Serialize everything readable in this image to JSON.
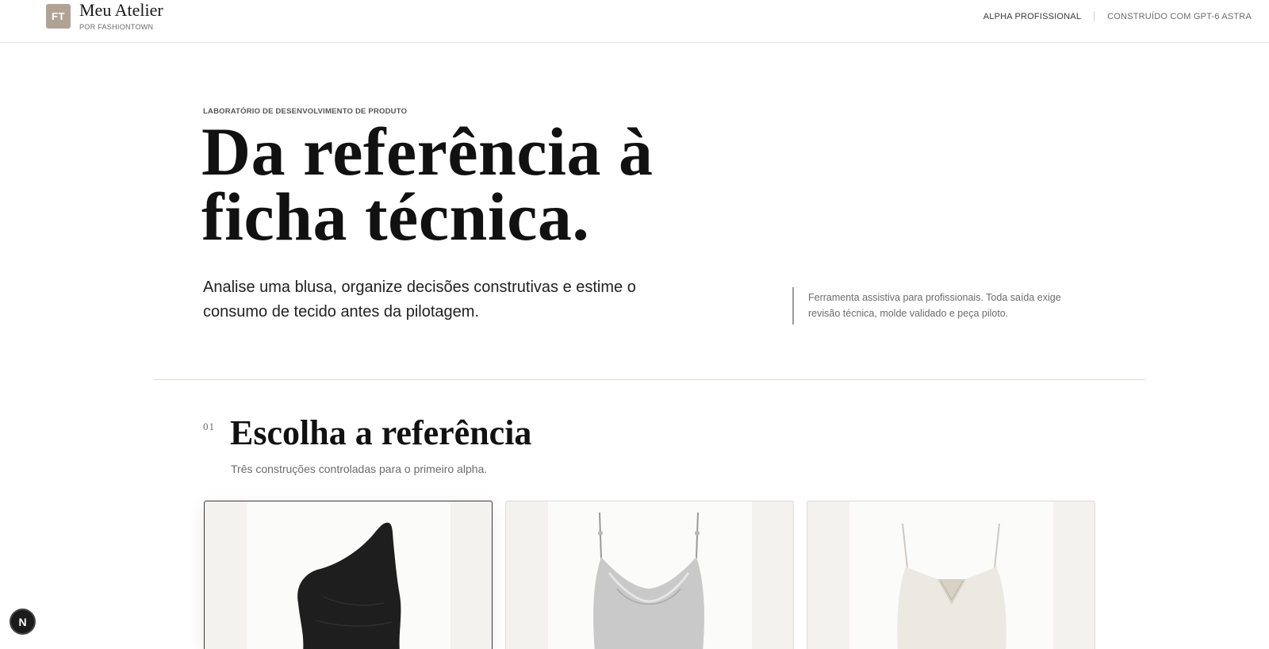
{
  "header": {
    "logo_initials": "FT",
    "brand_name": "Meu Atelier",
    "brand_sub": "POR FASHIONTOWN",
    "nav": [
      "ALPHA PROFISSIONAL",
      "CONSTRUÍDO COM GPT-6 ASTRA"
    ]
  },
  "hero": {
    "eyebrow": "LABORATÓRIO DE DESENVOLVIMENTO DE PRODUTO",
    "title_line1": "Da referência à",
    "title_line2": "ficha técnica.",
    "description": "Analise uma blusa, organize decisões construtivas e estime o consumo de tecido antes da pilotagem.",
    "note": "Ferramenta assistiva para profissionais. Toda saída exige revisão técnica, molde validado e peça piloto."
  },
  "section": {
    "number": "01",
    "title": "Escolha a referência",
    "subtitle": "Três construções controladas para o primeiro alpha."
  },
  "cards": [
    {
      "garment": "black one-shoulder draped top",
      "selected": true
    },
    {
      "garment": "silver satin cowl-neck camisole",
      "selected": false
    },
    {
      "garment": "ivory camisole with lace insert",
      "selected": false
    }
  ],
  "fab": {
    "label": "N"
  }
}
